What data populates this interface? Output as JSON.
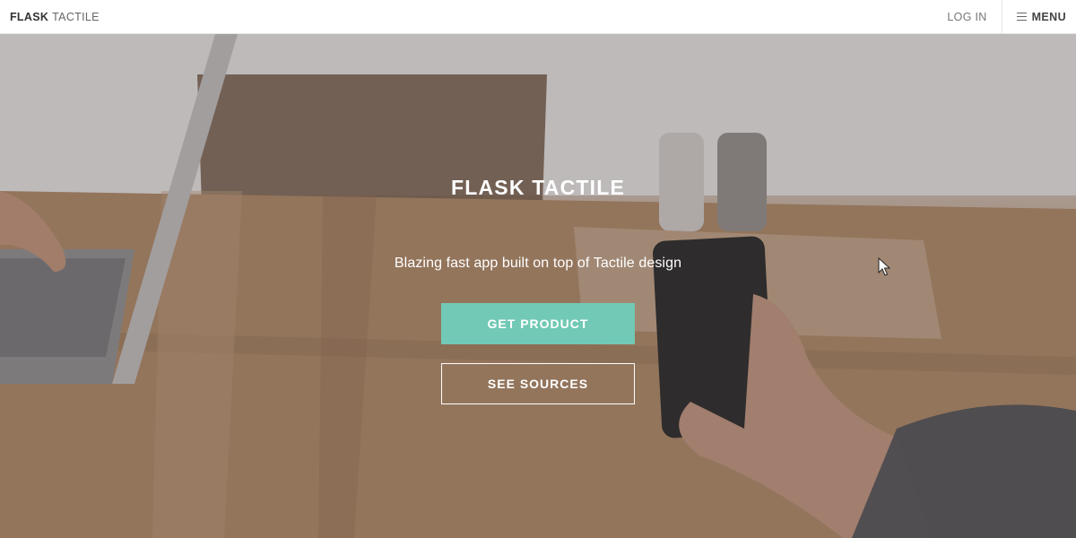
{
  "nav": {
    "brand_bold": "FLASK",
    "brand_light": "TACTILE",
    "login": "LOG IN",
    "menu": "MENU",
    "menu_icon": "hamburger-icon"
  },
  "hero": {
    "title": "FLASK TACTILE",
    "subtitle": "Blazing fast app built on top of Tactile design",
    "primary_button": "GET PRODUCT",
    "secondary_button": "SEE SOURCES"
  },
  "colors": {
    "accent": "#72c9b5",
    "nav_bg": "#ffffff",
    "hero_text": "#ffffff"
  }
}
